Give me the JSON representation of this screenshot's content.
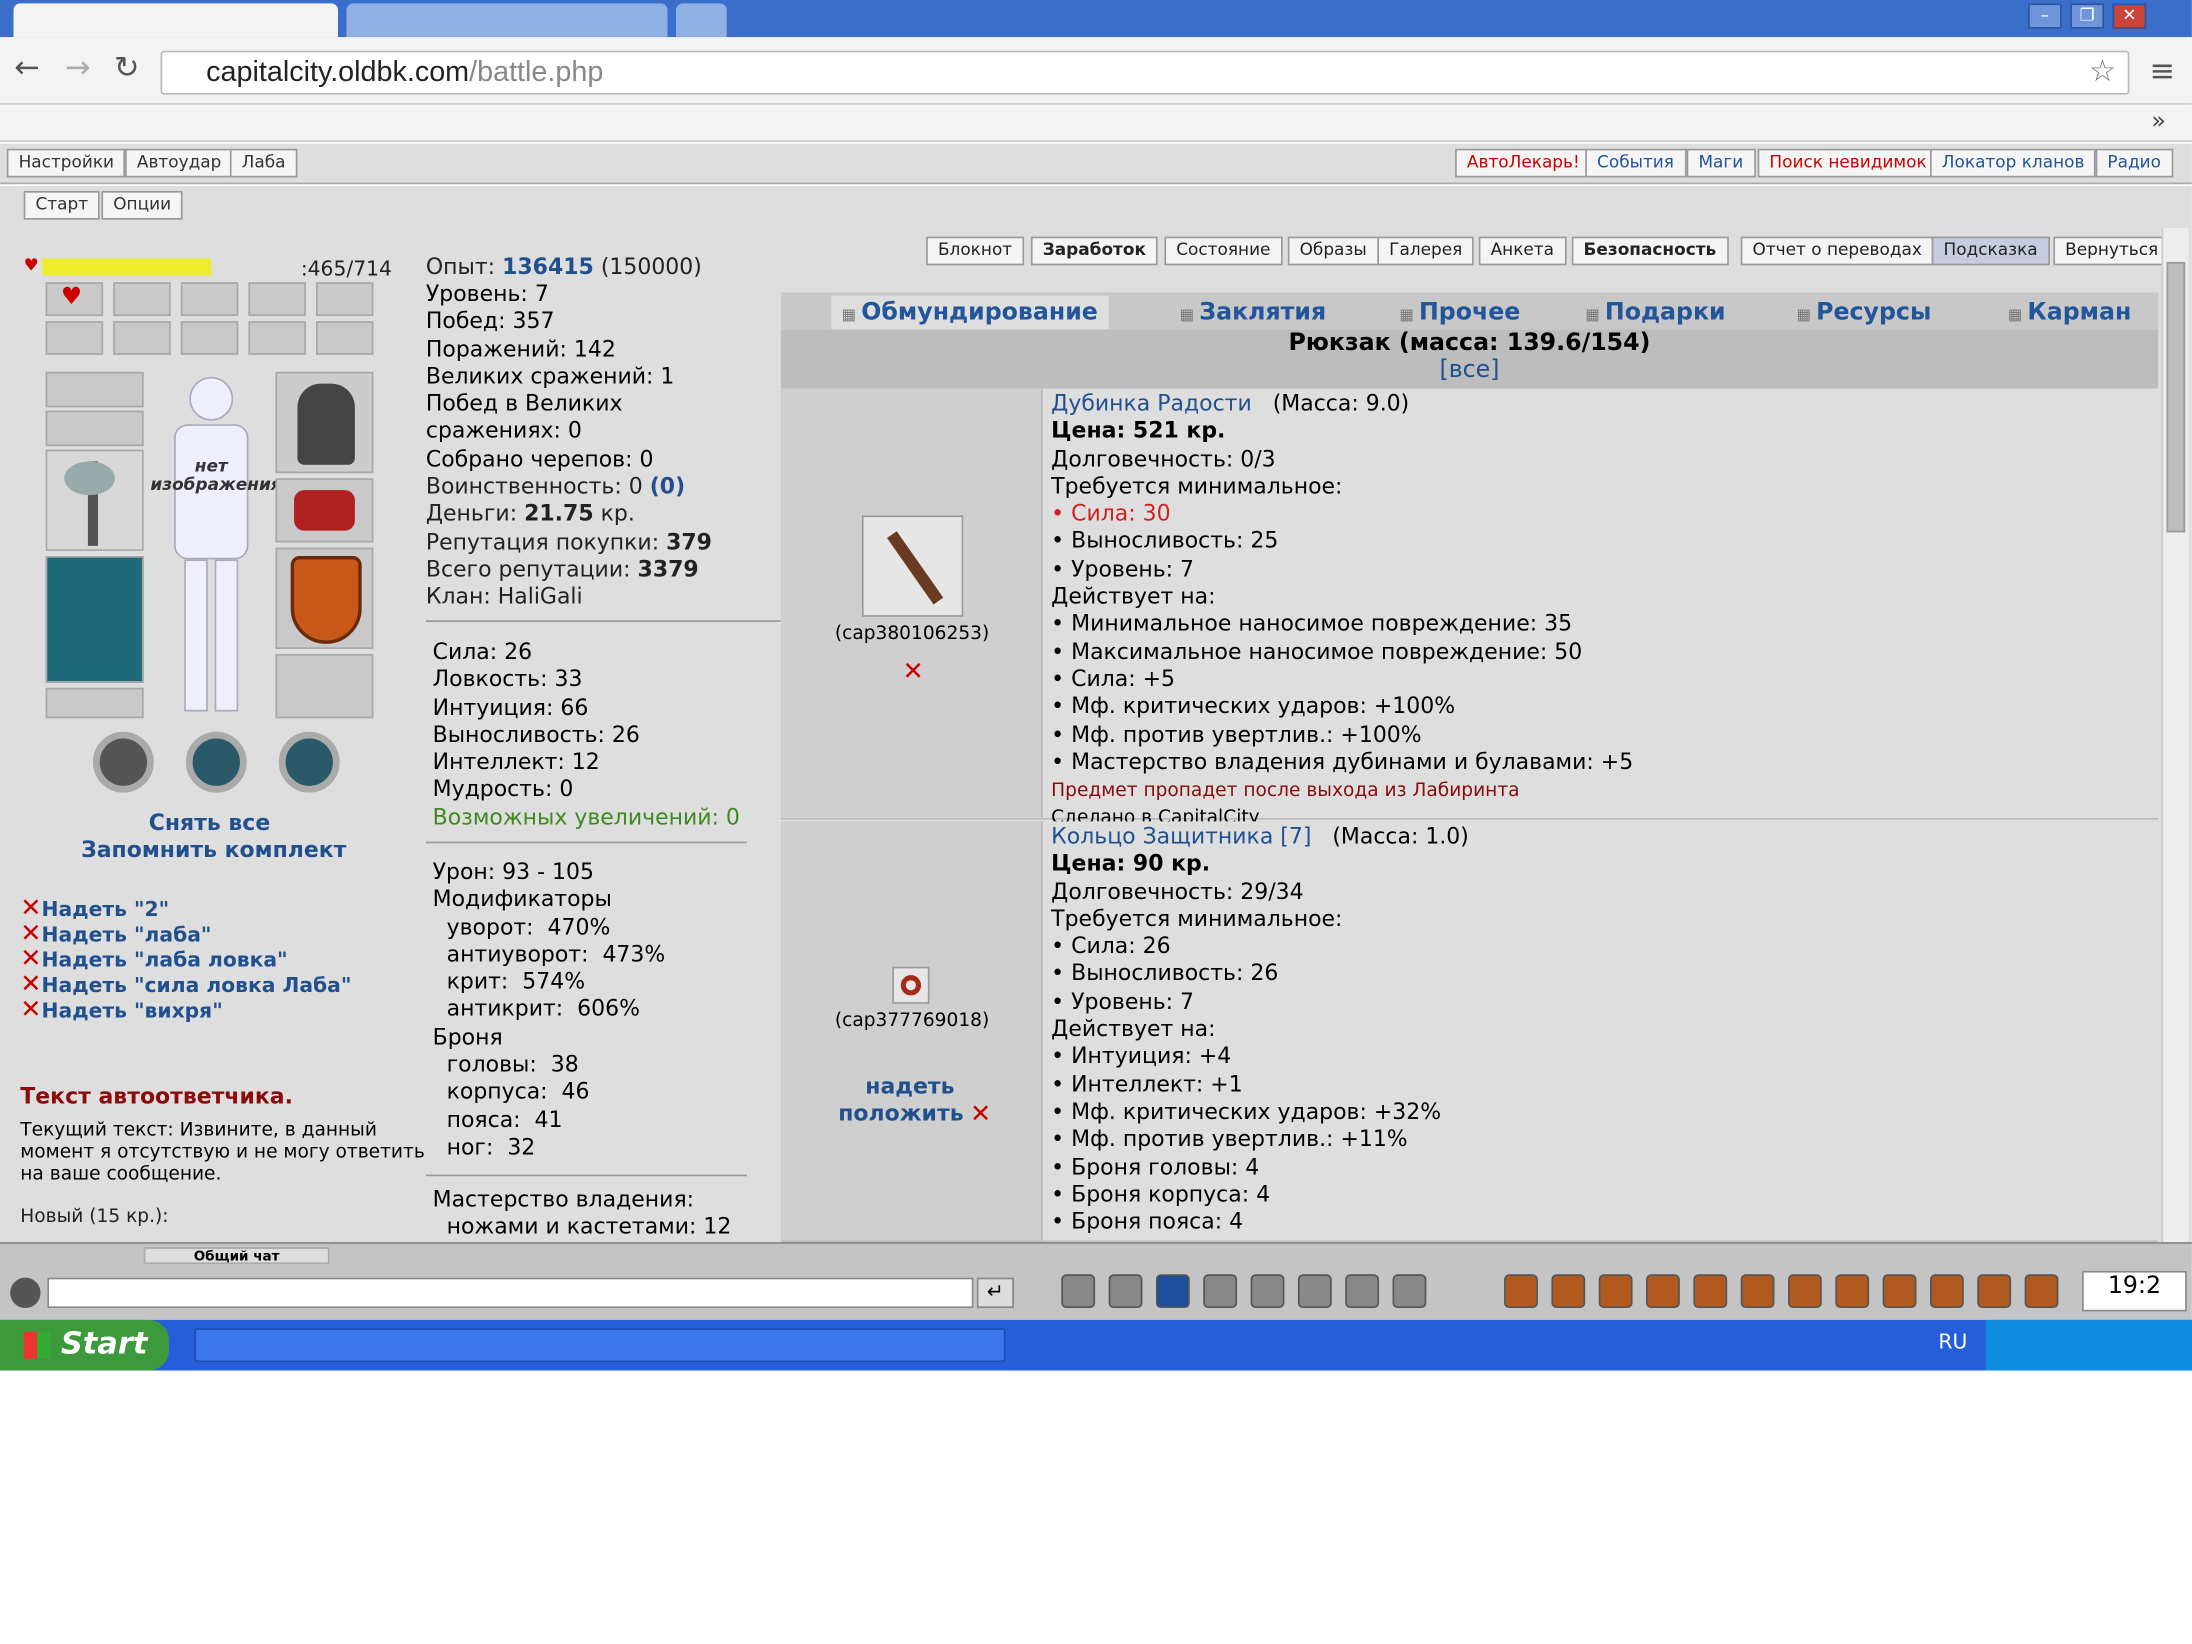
{
  "browser": {
    "url_host": "capitalcity.oldbk.com",
    "url_path": "/battle.php",
    "more_bookmarks": "»"
  },
  "menu1": [
    "Настройки",
    "Автоудар",
    "Лаба"
  ],
  "menu1_right": [
    "АвтоЛекарь!",
    "События",
    "Маги",
    "Поиск невидимок",
    "Локатор кланов",
    "Радио"
  ],
  "menu2": [
    "Старт",
    "Опции"
  ],
  "char": {
    "hp": ":465/714",
    "no_image": "нет изображения",
    "take_off_all": "Снять все",
    "remember_set": "Запомнить комплект",
    "sets": [
      "Надеть \"2\"",
      "Надеть \"лаба\"",
      "Надеть \"лаба ловка\"",
      "Надеть \"сила ловка Лаба\"",
      "Надеть \"вихря\""
    ],
    "autoreply_title": "Текст автоответчика.",
    "autoreply_text": "Текущий текст: Извините, в данный момент я отсутствую и не могу ответить на ваше сообщение.",
    "new_cost": "Новый (15 кр.):"
  },
  "stats": {
    "exp_label": "Опыт:",
    "exp": "136415",
    "exp_next": "(150000)",
    "lines1": [
      "Уровень: 7",
      "Побед: 357",
      "Поражений: 142",
      "Великих сражений: 1",
      "Побед в Великих",
      "сражениях: 0",
      "Собрано черепов: 0"
    ],
    "militancy_label": "Воинственность: 0",
    "militancy_val": "(0)",
    "money_label": "Деньги:",
    "money_val": "21.75",
    "money_unit": "кр.",
    "rep_buy_label": "Репутация покупки:",
    "rep_buy_val": "379",
    "rep_total_label": "Всего репутации:",
    "rep_total_val": "3379",
    "clan": "Клан: HaliGali",
    "attrs": [
      "Сила: 26",
      "Ловкость: 33",
      "Интуиция: 66",
      "Выносливость: 26",
      "Интеллект: 12",
      "Мудрость: 0"
    ],
    "possible_up": "Возможных увеличений: 0",
    "damage": [
      "Урон: 93 - 105",
      "Модификаторы",
      "  уворот:  470%",
      "  антиуворот:  473%",
      "  крит:  574%",
      "  антикрит:  606%",
      "Броня",
      "  головы:  38",
      "  корпуса:  46",
      "  пояса:  41",
      "  ног:  32"
    ],
    "mastery": [
      "Мастерство владения:",
      "  ножами и кастетами: 12"
    ]
  },
  "topbuttons": [
    "Блокнот",
    "Заработок",
    "Состояние",
    "Образы",
    "Галерея",
    "Анкета",
    "Безопасность",
    "Отчет о переводах",
    "Подсказка",
    "Вернуться"
  ],
  "invtabs": [
    "Обмундирование",
    "Заклятия",
    "Прочее",
    "Подарки",
    "Ресурсы",
    "Карман"
  ],
  "rucksack": {
    "title": "Рюкзак (масса: 139.6/154)",
    "all": "[все]"
  },
  "items": [
    {
      "id": "(cap380106253)",
      "name": "Дубинка Радости",
      "mass": "(Масса: 9.0)",
      "price": "Цена: 521 кр.",
      "lines": [
        "Долговечность: 0/3",
        "Требуется минимальное:"
      ],
      "req_red": "• Сила: 30",
      "lines2": [
        "• Выносливость: 25",
        "• Уровень: 7",
        "Действует на:",
        "• Минимальное наносимое повреждение: 35",
        "• Максимальное наносимое повреждение: 50",
        "• Сила: +5",
        "• Мф. критических ударов: +100%",
        "• Мф. против увертлив.: +100%",
        "• Мастерство владения дубинами и булавами: +5"
      ],
      "warn": "Предмет пропадет после выхода из Лабиринта",
      "made": "Сделано в CapitalCity"
    },
    {
      "id": "(cap377769018)",
      "name": "Кольцо Защитника [7]",
      "mass": "(Масса: 1.0)",
      "price": "Цена: 90 кр.",
      "actions": [
        "надеть",
        "положить"
      ],
      "lines": [
        "Долговечность: 29/34",
        "Требуется минимальное:",
        "• Сила: 26",
        "• Выносливость: 26",
        "• Уровень: 7",
        "Действует на:",
        "• Интуиция: +4",
        "• Интеллект: +1",
        "• Мф. критических ударов: +32%",
        "• Мф. против увертлив.: +11%",
        "• Броня головы: 4",
        "• Броня корпуса: 4",
        "• Броня пояса: 4"
      ]
    }
  ],
  "chat_tabs": [
    "Общий чат"
  ],
  "taskbar": {
    "start": "Start",
    "lang": "RU",
    "clock": "19:2"
  }
}
